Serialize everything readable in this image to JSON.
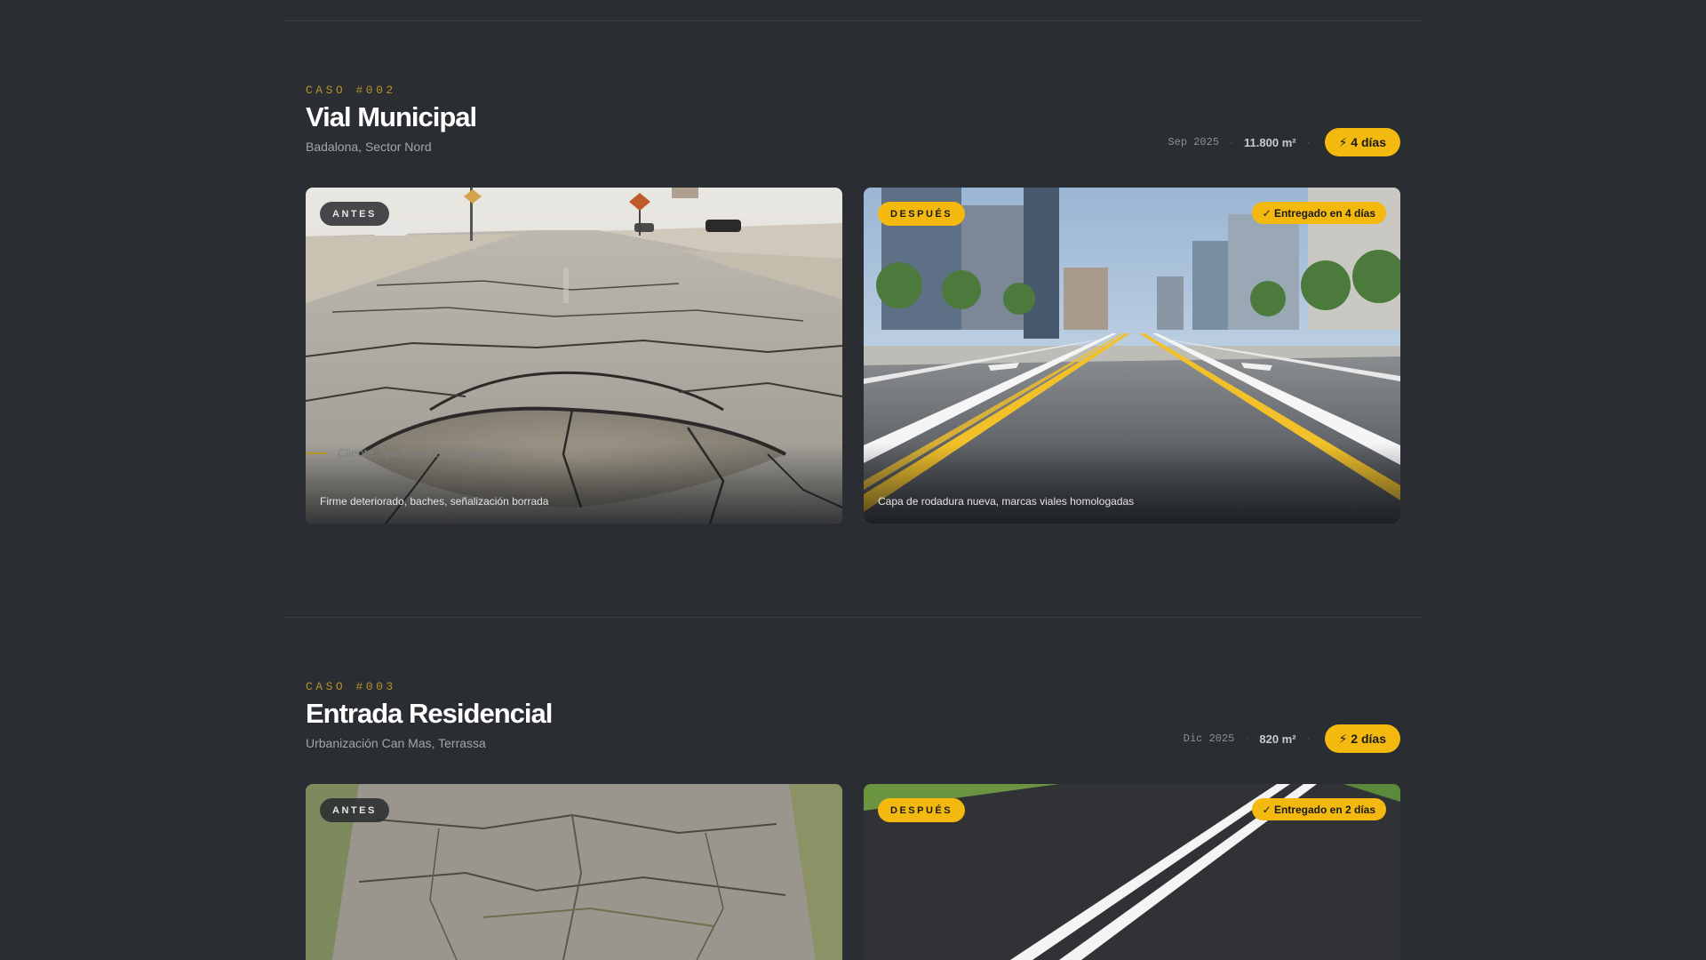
{
  "cases": [
    {
      "tag": "CASO #002",
      "title": "Vial Municipal",
      "location": "Badalona, Sector Nord",
      "date": "Sep 2025",
      "area": "11.800 m²",
      "duration": "⚡ 4 días",
      "before": {
        "label": "ANTES",
        "caption": "Firme deteriorado, baches, señalización borrada"
      },
      "after": {
        "label": "DESPUÉS",
        "badge": "✓ Entregado en 4 días",
        "caption": "Capa de rodadura nueva, marcas viales homologadas"
      },
      "client": "Cliente: Ajuntament de Badalona"
    },
    {
      "tag": "CASO #003",
      "title": "Entrada Residencial",
      "location": "Urbanización Can Mas, Terrassa",
      "date": "Dic 2025",
      "area": "820 m²",
      "duration": "⚡ 2 días",
      "before": {
        "label": "ANTES"
      },
      "after": {
        "label": "DESPUÉS",
        "badge": "✓ Entregado en 2 días"
      }
    }
  ],
  "colors": {
    "accent": "#f3b90e",
    "background": "#2a2d31",
    "tag": "#b8902a"
  }
}
